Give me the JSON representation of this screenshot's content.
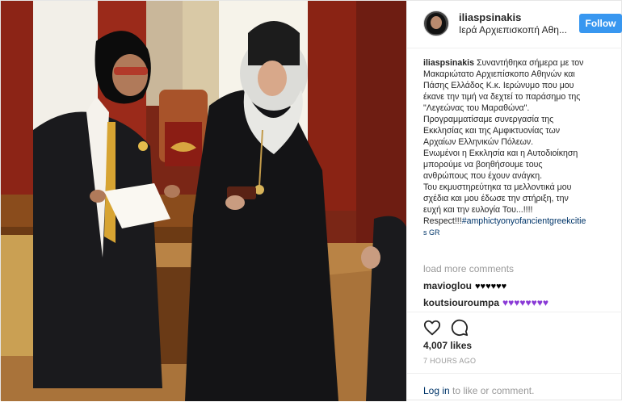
{
  "header": {
    "username": "iliaspsinakis",
    "location": "Ιερά Αρχιεπισκοπή Αθη...",
    "follow_label": "Follow"
  },
  "caption": {
    "username": "iliaspsinakis",
    "lines": [
      "Συναντήθηκα σήμερα με τον",
      "Μακαριώτατο Αρχιεπίσκοπο Αθηνών και",
      "Πάσης Ελλάδος Κ.κ. Ιερώνυμο που μου",
      "έκανε την τιμή να δεχτεί το παράσημο της",
      "\"Λεγεώνας του Μαραθώνα\".",
      "Προγραμματίσαμε συνεργασία της",
      "Εκκλησίας και της Αμφικτυονίας των",
      "Αρχαίων Ελληνικών Πόλεων.",
      "Ενωμένοι η Εκκλησία και η Αυτοδιοίκηση",
      "μπορούμε να βοηθήσουμε τους",
      "ανθρώπους που έχουν ανάγκη.",
      "Του εκμυστηρεύτηκα τα μελλοντικά μου",
      "σχέδια και μου έδωσε την στήριξη, την",
      "ευχή και την ευλογία Του...!!!!"
    ],
    "last_line_text": "Respect!!!",
    "hashtag": "#amphictyonyofancientgreekcitie",
    "hashtag_tail": "s GR"
  },
  "load_more": "load more comments",
  "comments": [
    {
      "user": "mavioglou",
      "text": "♥♥♥♥♥♥"
    },
    {
      "user": "koutsiouroumpa",
      "text": "♥♥♥♥♥♥♥♥"
    }
  ],
  "likes": "4,007 likes",
  "time": "7 HOURS AGO",
  "login": {
    "link": "Log in",
    "rest": " to like or comment."
  },
  "colors": {
    "follow_button": "#3897f0",
    "link": "#003569",
    "muted": "#999999",
    "purple_heart": "#8a3ad6"
  },
  "icons": {
    "like": "heart-outline-icon",
    "comment": "speech-bubble-icon",
    "avatar": "profile-avatar"
  }
}
